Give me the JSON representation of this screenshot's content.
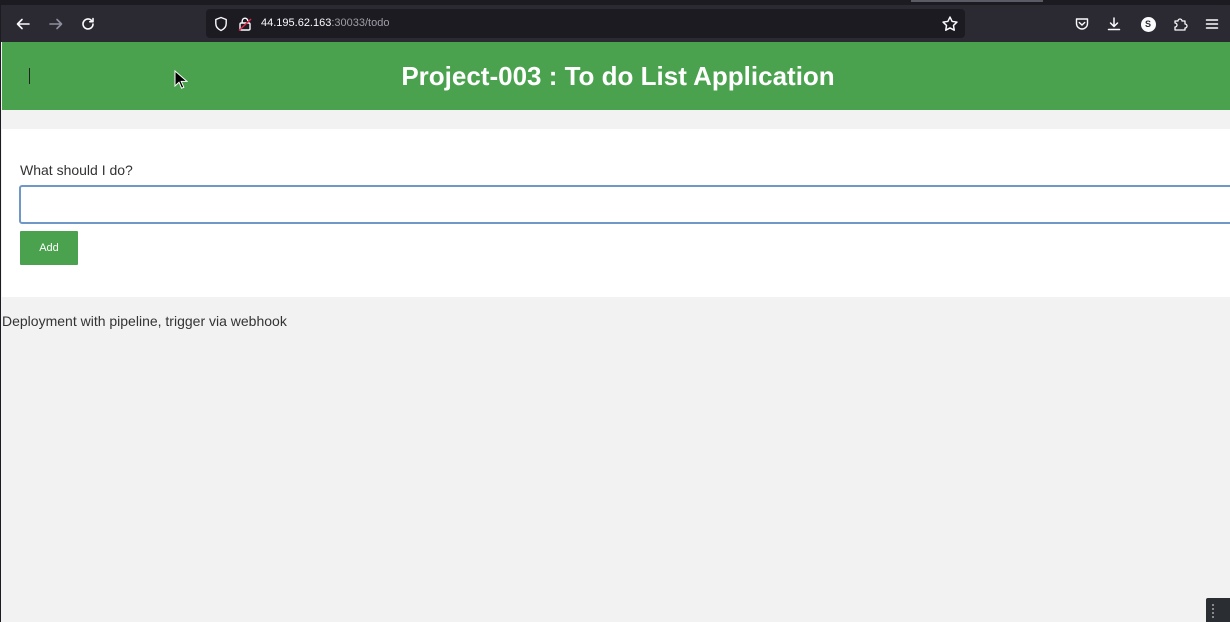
{
  "browser": {
    "url_host": "44.195.62.163",
    "url_rest": ":30033/todo",
    "avatar_letter": "S"
  },
  "app": {
    "title": "Project-003 : To do List Application",
    "form_label": "What should I do?",
    "input_value": "",
    "add_label": "Add",
    "footer": "Deployment with pipeline, trigger via webhook"
  },
  "colors": {
    "accent_green": "#4aa24e",
    "input_focus_border": "#6f97c7",
    "toolbar_bg": "#2b2a33"
  }
}
